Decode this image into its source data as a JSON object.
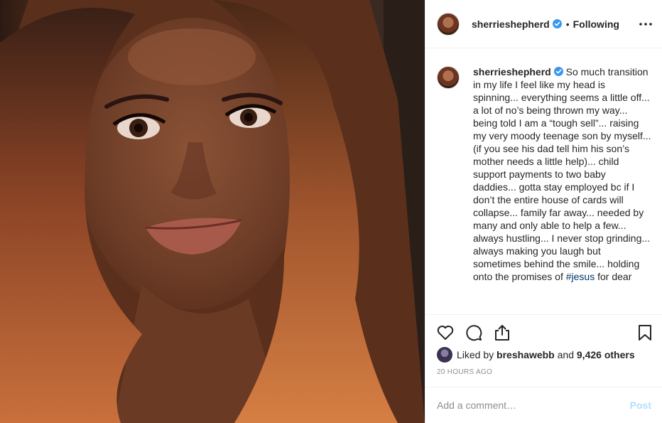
{
  "post": {
    "username": "sherrieshepherd",
    "separator": "•",
    "following_label": "Following",
    "more_icon": "more-horizontal-icon",
    "verified_icon": "verified-badge-icon"
  },
  "caption": {
    "username": "sherrieshepherd",
    "text_before_hashtag": "So much transition in my life I feel like my head is spinning... everything seems a little off... a lot of no’s being thrown my way... being told I am a “tough sell”... raising my very moody teenage son by myself... (if you see his dad tell him his son’s mother needs a little help)... child support payments to two baby daddies... gotta stay employed bc if I don’t the entire house of cards will collapse... family far away... needed by many and only able to help a few... always hustling... I never stop grinding... always making you laugh but sometimes behind the smile... holding onto the promises of ",
    "hashtag": "#jesus",
    "text_after_hashtag": " for dear"
  },
  "actions": {
    "like_icon": "heart-icon",
    "comment_icon": "comment-bubble-icon",
    "share_icon": "share-icon",
    "save_icon": "bookmark-icon"
  },
  "likes": {
    "prefix": "Liked by ",
    "user": "breshawebb",
    "middle": " and ",
    "count": "9,426 others"
  },
  "timestamp": "20 HOURS AGO",
  "comment_box": {
    "placeholder": "Add a comment…",
    "post_label": "Post"
  },
  "colors": {
    "verified": "#3897f0",
    "hashtag": "#003569",
    "post_disabled": "#b2dffc",
    "muted": "#8e8e8e"
  }
}
